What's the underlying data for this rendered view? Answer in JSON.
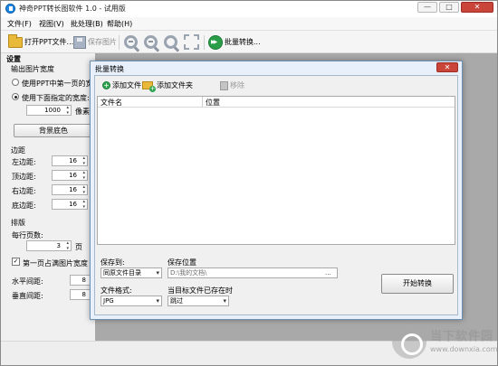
{
  "window": {
    "title": "神奇PPT转长图软件 1.0 - 试用版",
    "minimize": "—",
    "maximize": "□",
    "close": "✕"
  },
  "menu": [
    "文件(F)",
    "视图(V)",
    "批处理(B)",
    "帮助(H)"
  ],
  "toolbar": {
    "open_ppt": "打开PPT文件...",
    "save_image": "保存图片",
    "batch_convert": "批量转换..."
  },
  "settings": {
    "header": "设置",
    "output_width": {
      "title": "输出图片宽度",
      "option_first_page": "使用PPT中第一页的宽度",
      "option_custom": "使用下面指定的宽度:",
      "value": "1000",
      "unit": "像素"
    },
    "background_button": "背景底色",
    "margins": {
      "title": "边距",
      "left_label": "左边距:",
      "left_value": "16",
      "top_label": "顶边距:",
      "top_value": "16",
      "right_label": "右边距:",
      "right_value": "16",
      "bottom_label": "底边距:",
      "bottom_value": "16"
    },
    "layout": {
      "title": "排版",
      "pages_per_row_label": "每行页数:",
      "pages_per_row_value": "3",
      "pages_unit": "页",
      "first_page_full": "第一页占满图片宽度",
      "h_spacing_label": "水平间距:",
      "h_spacing_value": "8",
      "v_spacing_label": "垂直间距:",
      "v_spacing_value": "8"
    }
  },
  "dialog": {
    "title": "批量转换",
    "close": "✕",
    "add_file": "添加文件",
    "add_folder": "添加文件夹",
    "remove": "移除",
    "columns": [
      "文件名",
      "位置"
    ],
    "save_to_label": "保存到:",
    "save_to_value": "同原文件目录",
    "save_location_label": "保存位置",
    "save_location_value": "D:\\我的文档\\",
    "browse": "...",
    "format_label": "文件格式:",
    "format_value": "JPG",
    "exists_label": "当目标文件已存在时",
    "exists_value": "跳过",
    "start_button": "开始转换"
  },
  "watermark": {
    "text": "当下软件园",
    "url": "www.downxia.com"
  }
}
